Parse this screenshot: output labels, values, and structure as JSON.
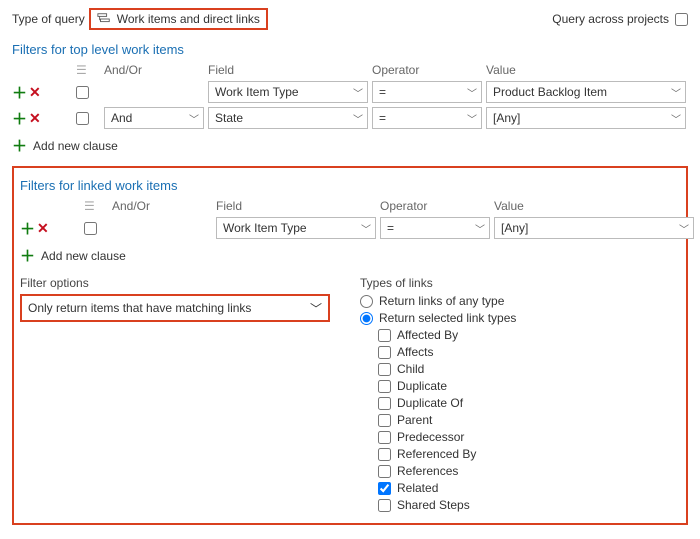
{
  "top": {
    "type_label": "Type of query",
    "type_value": "Work items and direct links",
    "cross_label": "Query across projects",
    "cross_checked": false
  },
  "headers": {
    "andor": "And/Or",
    "field": "Field",
    "operator": "Operator",
    "value": "Value"
  },
  "section_top": {
    "title": "Filters for top level work items",
    "rows": [
      {
        "andor": "",
        "field": "Work Item Type",
        "op": "=",
        "val": "Product Backlog Item"
      },
      {
        "andor": "And",
        "field": "State",
        "op": "=",
        "val": "[Any]"
      }
    ],
    "add_label": "Add new clause"
  },
  "section_linked": {
    "title": "Filters for linked work items",
    "rows": [
      {
        "andor": "",
        "field": "Work Item Type",
        "op": "=",
        "val": "[Any]"
      }
    ],
    "add_label": "Add new clause"
  },
  "filter_options": {
    "label": "Filter options",
    "value": "Only return items that have matching links"
  },
  "link_types": {
    "label": "Types of links",
    "radio_any": "Return links of any type",
    "radio_selected": "Return selected link types",
    "selected": "selected",
    "items": [
      {
        "label": "Affected By",
        "checked": false
      },
      {
        "label": "Affects",
        "checked": false
      },
      {
        "label": "Child",
        "checked": false
      },
      {
        "label": "Duplicate",
        "checked": false
      },
      {
        "label": "Duplicate Of",
        "checked": false
      },
      {
        "label": "Parent",
        "checked": false
      },
      {
        "label": "Predecessor",
        "checked": false
      },
      {
        "label": "Referenced By",
        "checked": false
      },
      {
        "label": "References",
        "checked": false
      },
      {
        "label": "Related",
        "checked": true
      },
      {
        "label": "Shared Steps",
        "checked": false
      }
    ]
  }
}
